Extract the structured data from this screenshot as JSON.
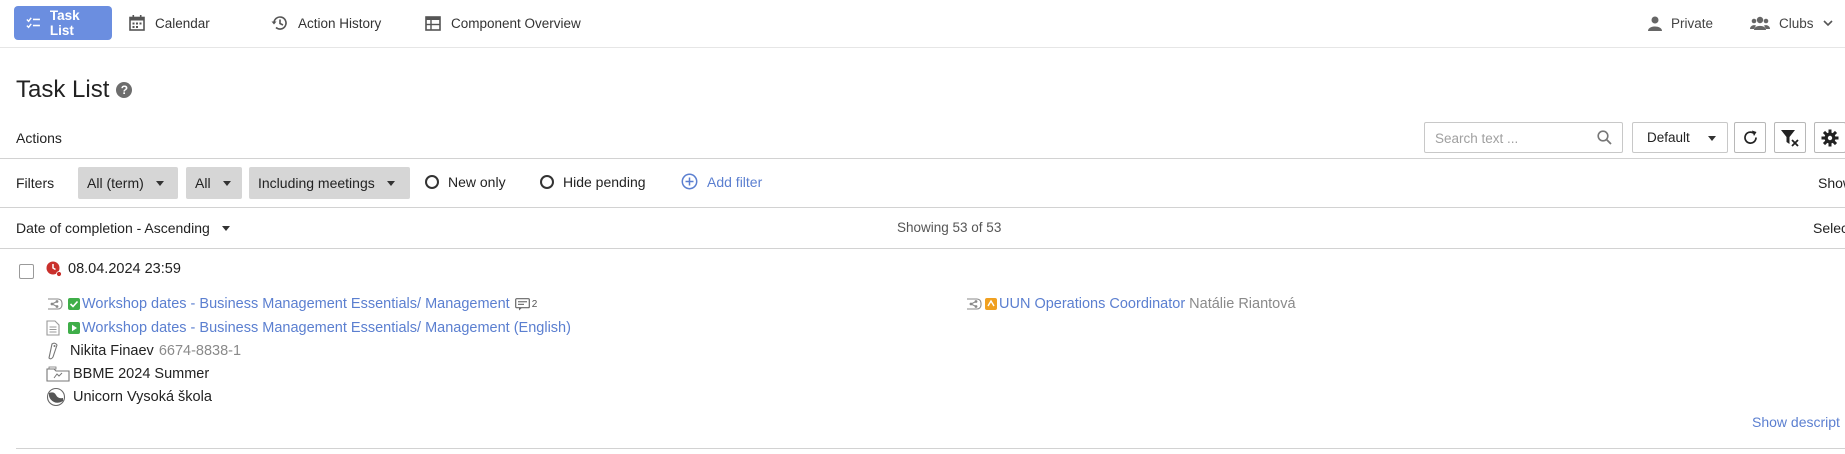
{
  "nav": {
    "tabs": [
      {
        "label": "Task List",
        "icon": "task-list-icon"
      },
      {
        "label": "Calendar",
        "icon": "calendar-icon"
      },
      {
        "label": "Action History",
        "icon": "history-icon"
      },
      {
        "label": "Component Overview",
        "icon": "table-icon"
      }
    ],
    "private_label": "Private",
    "clubs_label": "Clubs",
    "active_color": "#6b8ee0"
  },
  "page": {
    "title": "Task List"
  },
  "actions": {
    "label": "Actions",
    "search_placeholder": "Search text ...",
    "view_select": "Default"
  },
  "filters": {
    "label": "Filters",
    "chips": [
      "All (term)",
      "All",
      "Including meetings"
    ],
    "new_only": "New only",
    "hide_pending": "Hide pending",
    "add_filter": "Add filter",
    "right_truncated": "Show"
  },
  "sorting": {
    "label": "Date of completion - Ascending",
    "count": "Showing 53 of 53",
    "right_truncated": "Selec"
  },
  "task": {
    "deadline": "08.04.2024 23:59",
    "workshop_link": "Workshop dates - Business Management Essentials/ Management",
    "comment_count": "2",
    "workshop_link_en": "Workshop dates - Business Management Essentials/ Management (English)",
    "person_name": "Nikita Finaev",
    "person_id": "6674-8838-1",
    "course": "BBME 2024 Summer",
    "school": "Unicorn Vysoká škola",
    "role_link": "UUN Operations Coordinator",
    "role_person": "Natálie Riantová",
    "show_description": "Show descript"
  }
}
